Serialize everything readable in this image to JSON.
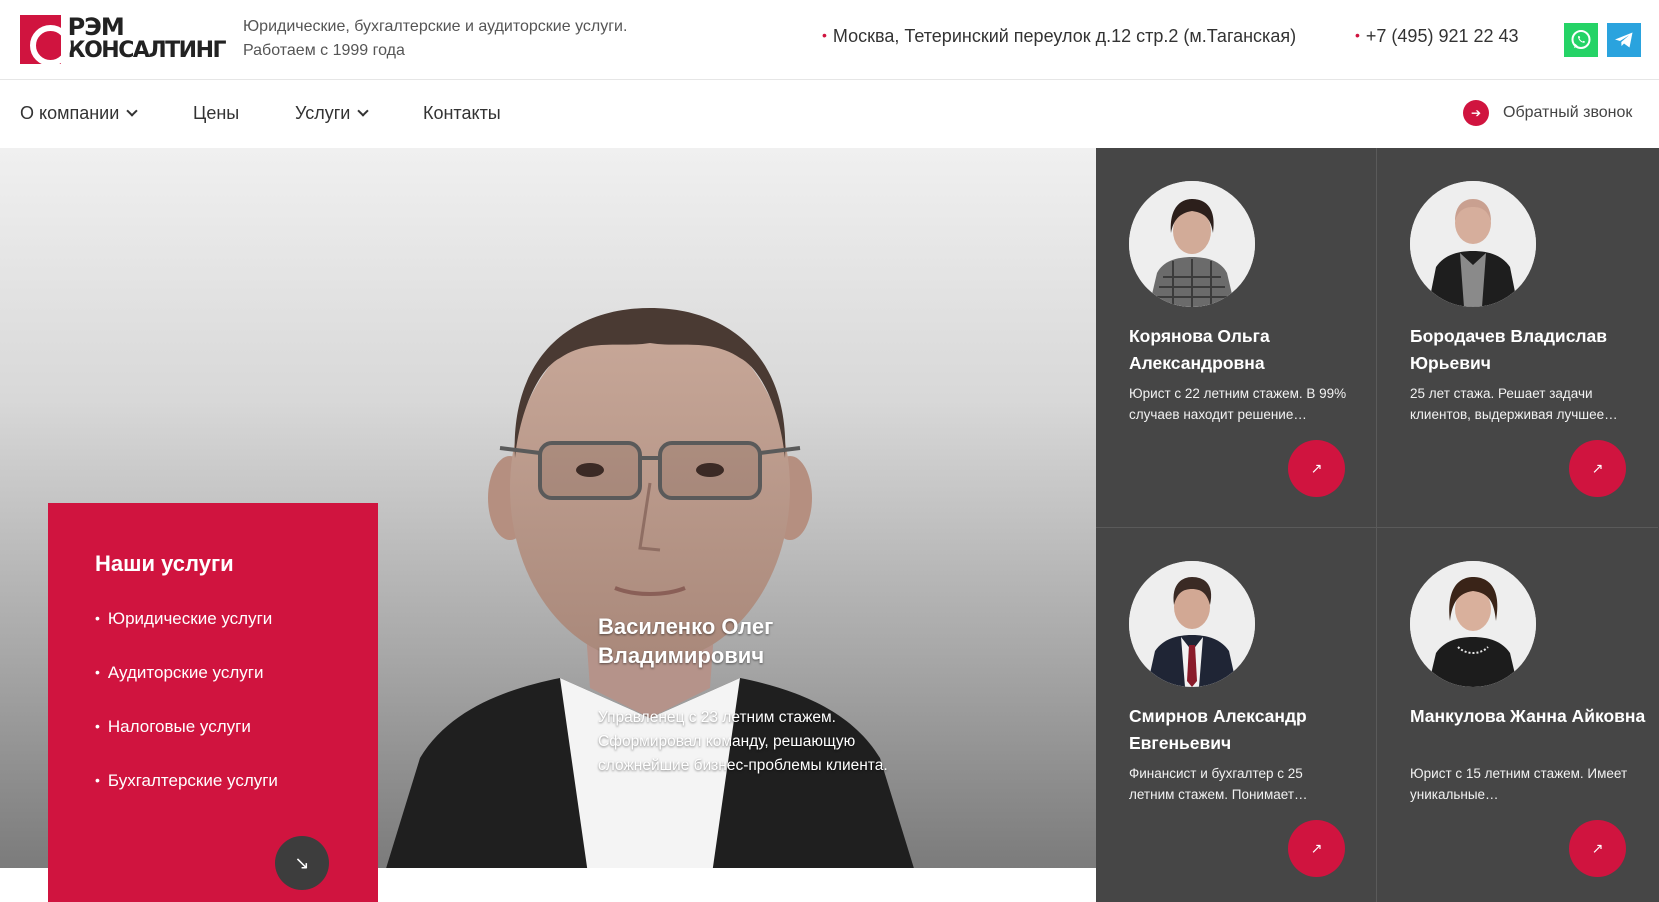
{
  "header": {
    "logo_line1": "РЭМ",
    "logo_line2": "КОНСАЛТИНГ",
    "tagline_line1": "Юридические, бухгалтерские и аудиторские услуги.",
    "tagline_line2": "Работаем с 1999 года",
    "address": "Москва, Тетеринский переулок д.12 стр.2 (м.Таганская)",
    "phone": "+7 (495) 921 22 43"
  },
  "nav": {
    "about": "О компании",
    "prices": "Цены",
    "services": "Услуги",
    "contacts": "Контакты",
    "callback": "Обратный звонок"
  },
  "hero": {
    "name": "Василенко Олег Владимирович",
    "description": "Управленец с 23 летним стажем. Сформировал команду, решающую сложнейшие бизнес-проблемы клиента."
  },
  "services": {
    "title": "Наши услуги",
    "items": [
      "Юридические услуги",
      "Аудиторские услуги",
      "Налоговые услуги",
      "Бухгалтерские услуги"
    ]
  },
  "team": [
    {
      "name": "Корянова Ольга Александровна",
      "description": "Юрист с 22 летним стажем. В 99% случаев находит решение…"
    },
    {
      "name": "Бородачев Владислав Юрьевич",
      "description": "25 лет стажа. Решает задачи клиентов, выдерживая лучшее…"
    },
    {
      "name": "Смирнов Александр Евгеньевич",
      "description": "Финансист и бухгалтер с 25 летним стажем. Понимает…"
    },
    {
      "name": "Манкулова Жанна Айковна",
      "description": "Юрист с 15 летним стажем. Имеет уникальные…"
    }
  ],
  "colors": {
    "accent": "#d0143f",
    "team_bg": "#464646",
    "whatsapp": "#25d366",
    "telegram": "#2aa3de"
  },
  "icons": {
    "whatsapp": "whatsapp-icon",
    "telegram": "telegram-icon",
    "callback": "arrow-right-icon",
    "card_link": "arrow-up-right-icon",
    "services_scroll": "arrow-down-right-icon"
  }
}
